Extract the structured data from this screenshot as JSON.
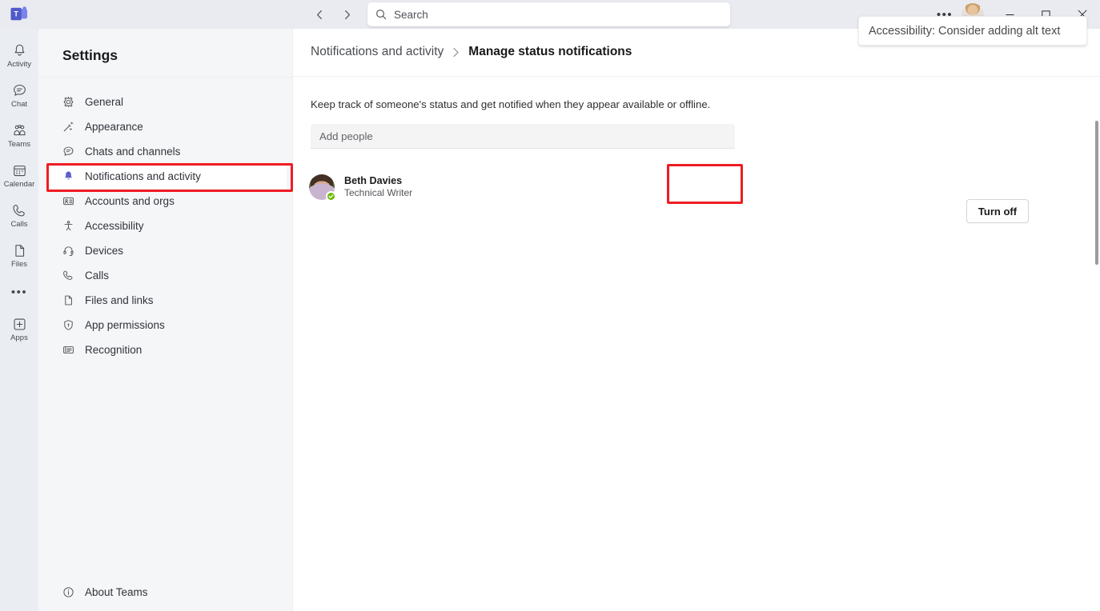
{
  "titlebar": {
    "logo_icon": "teams-logo",
    "back_icon": "chevron-left-icon",
    "forward_icon": "chevron-right-icon",
    "more_label": "•••",
    "minimize_icon": "minimize-icon",
    "maximize_icon": "maximize-icon",
    "close_icon": "close-icon",
    "presence": "available"
  },
  "search": {
    "placeholder": "Search",
    "value": "",
    "icon": "search-icon"
  },
  "tooltip": {
    "text": "Accessibility: Consider adding alt text"
  },
  "rail": {
    "items": [
      {
        "label": "Activity",
        "icon": "bell-icon"
      },
      {
        "label": "Chat",
        "icon": "chat-icon"
      },
      {
        "label": "Teams",
        "icon": "teams-people-icon"
      },
      {
        "label": "Calendar",
        "icon": "calendar-icon"
      },
      {
        "label": "Calls",
        "icon": "phone-icon"
      },
      {
        "label": "Files",
        "icon": "file-icon"
      }
    ],
    "more_label": "•••",
    "apps": {
      "label": "Apps",
      "icon": "apps-plus-icon"
    }
  },
  "settings": {
    "title": "Settings",
    "items": [
      {
        "label": "General",
        "icon": "gear-icon",
        "selected": false
      },
      {
        "label": "Appearance",
        "icon": "wand-icon",
        "selected": false
      },
      {
        "label": "Chats and channels",
        "icon": "chat-bubble-icon",
        "selected": false
      },
      {
        "label": "Notifications and activity",
        "icon": "bell-icon",
        "selected": true
      },
      {
        "label": "Accounts and orgs",
        "icon": "contact-card-icon",
        "selected": false
      },
      {
        "label": "Accessibility",
        "icon": "accessibility-icon",
        "selected": false
      },
      {
        "label": "Devices",
        "icon": "headset-icon",
        "selected": false
      },
      {
        "label": "Calls",
        "icon": "phone-icon",
        "selected": false
      },
      {
        "label": "Files and links",
        "icon": "document-icon",
        "selected": false
      },
      {
        "label": "App permissions",
        "icon": "shield-icon",
        "selected": false
      },
      {
        "label": "Recognition",
        "icon": "badge-icon",
        "selected": false
      }
    ],
    "about": {
      "label": "About Teams",
      "icon": "info-icon"
    }
  },
  "content": {
    "breadcrumb_parent": "Notifications and activity",
    "breadcrumb_separator": "›",
    "breadcrumb_current": "Manage status notifications",
    "description": "Keep track of someone's status and get notified when they appear available or offline.",
    "add_people": {
      "placeholder": "Add people",
      "value": ""
    },
    "people": [
      {
        "name": "Beth Davies",
        "title": "Technical Writer",
        "presence": "available",
        "action_label": "Turn off"
      }
    ]
  },
  "annotations": {
    "accent_color": "#ee1d23",
    "highlight_nav": "Notifications and activity",
    "highlight_button": "Turn off"
  }
}
